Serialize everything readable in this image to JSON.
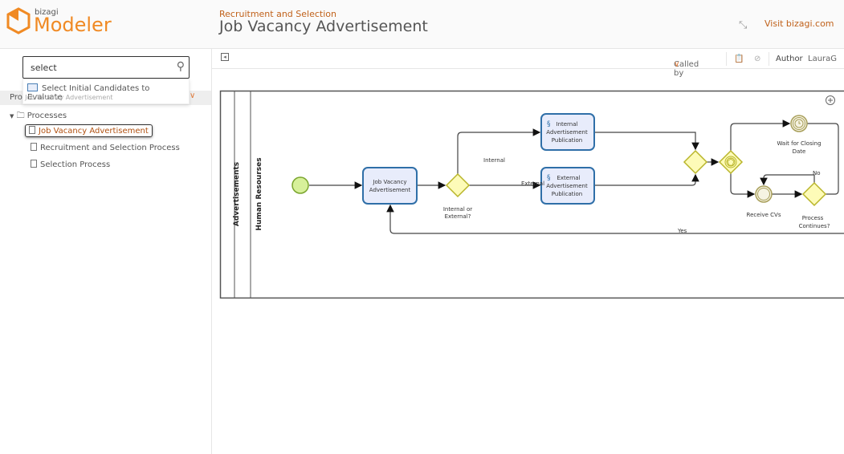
{
  "header": {
    "brand_small": "bizagi",
    "brand": "Modeler",
    "subtitle": "Recruitment and Selection",
    "title": "Job Vacancy Advertisement",
    "visit_link": "Visit bizagi.com"
  },
  "sidebar": {
    "search_value": "select",
    "suggestion": "Select Initial Candidates to Evaluate",
    "process_row_label": "Pro",
    "process_row_ghost": "Job Vacancy Advertisement",
    "folder": "Processes",
    "items": [
      {
        "label": "Job Vacancy Advertisement",
        "selected": true
      },
      {
        "label": "Recruitment and Selection Process"
      },
      {
        "label": "Selection Process"
      }
    ]
  },
  "toolbar": {
    "called_by": "Called by",
    "author_label": "Author",
    "author": "LauraG"
  },
  "diagram": {
    "pool": "Advertisements",
    "lane": "Human Resourses",
    "tasks": {
      "job": [
        "Job Vacancy",
        "Advertisement"
      ],
      "internal": [
        "Internal",
        "Advertisement",
        "Publication"
      ],
      "external": [
        "External",
        "Advertisement",
        "Publication"
      ]
    },
    "gateway1": [
      "Internal or",
      "External?"
    ],
    "flow_internal": "Internal",
    "flow_external": "External",
    "timer": [
      "Wait for Closing",
      "Date"
    ],
    "receive": "Receive CVs",
    "continue": [
      "Process",
      "Continues?"
    ],
    "flow_no": "No",
    "flow_yes": "Yes"
  },
  "colors": {
    "accent": "#f08a24",
    "task_fill": "#e8ecfb",
    "task_stroke": "#2f6fa8",
    "gateway_fill": "#fdfbb8",
    "gateway_stroke": "#b9b52a"
  }
}
